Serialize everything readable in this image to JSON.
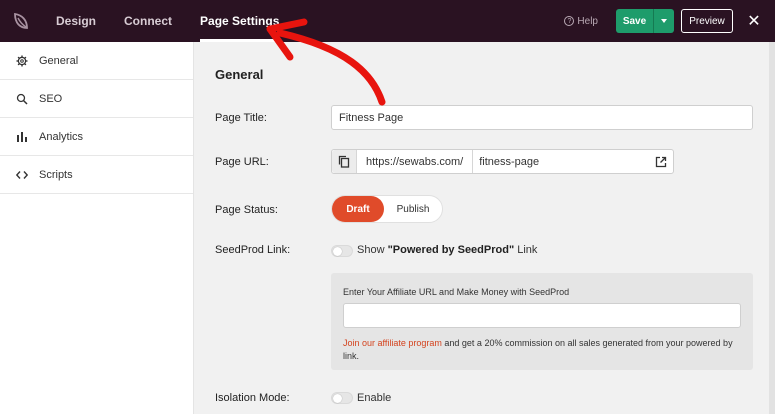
{
  "topbar": {
    "tabs": [
      {
        "label": "Design"
      },
      {
        "label": "Connect"
      },
      {
        "label": "Page Settings"
      }
    ],
    "help_label": "Help",
    "save_label": "Save",
    "preview_label": "Preview",
    "close_glyph": "✕"
  },
  "sidebar": {
    "items": [
      {
        "label": "General",
        "icon": "gear-icon"
      },
      {
        "label": "SEO",
        "icon": "search-icon"
      },
      {
        "label": "Analytics",
        "icon": "bar-chart-icon"
      },
      {
        "label": "Scripts",
        "icon": "code-icon"
      }
    ]
  },
  "main": {
    "section_title": "General",
    "page_title_label": "Page Title:",
    "page_title_value": "Fitness Page",
    "page_url_label": "Page URL:",
    "url_base": "https://sewabs.com/",
    "url_slug": "fitness-page",
    "page_status_label": "Page Status:",
    "status_draft": "Draft",
    "status_publish": "Publish",
    "seedprod_link_label": "SeedProd Link:",
    "seedprod_show": "Show",
    "seedprod_powered": "\"Powered by SeedProd\"",
    "seedprod_link_word": "Link",
    "affiliate_title": "Enter Your Affiliate URL and Make Money with SeedProd",
    "affiliate_link_text": "Join our affiliate program",
    "affiliate_rest": "and get a 20% commission on all sales generated from your powered by link.",
    "isolation_label": "Isolation Mode:",
    "isolation_enable": "Enable"
  },
  "colors": {
    "topbar_bg": "#2a1222",
    "save_green": "#1e9c6b",
    "draft_orange": "#e04b2a",
    "annotation_red": "#e8140e",
    "link_orange": "#d4441f"
  }
}
